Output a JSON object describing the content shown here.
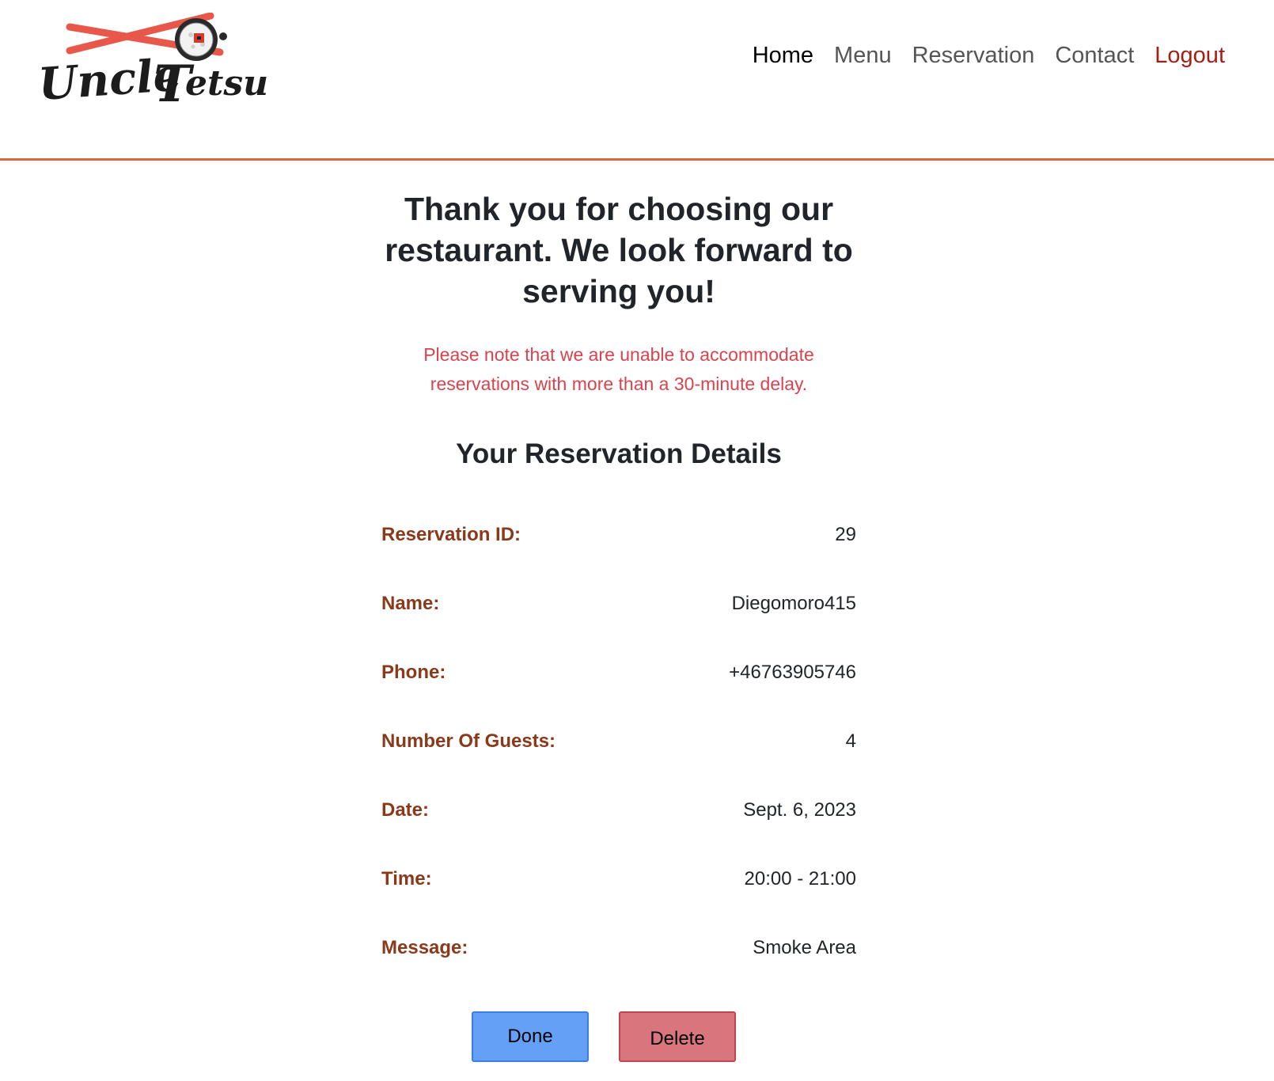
{
  "brand": {
    "logo_text": "Uncle Tetsu",
    "colors": {
      "chopsticks": "#e8584a",
      "text": "#1c1c1c"
    }
  },
  "nav": {
    "items": [
      {
        "label": "Home",
        "active": true
      },
      {
        "label": "Menu"
      },
      {
        "label": "Reservation"
      },
      {
        "label": "Contact"
      },
      {
        "label": "Logout"
      }
    ]
  },
  "main": {
    "thanks": "Thank you for choosing our restaurant. We look forward to serving you!",
    "note": "Please note that we are unable to accommodate reservations with more than a 30-minute delay.",
    "details_title": "Your Reservation Details",
    "details": [
      {
        "label": "Reservation ID:",
        "value": "29"
      },
      {
        "label": "Name:",
        "value": "Diegomoro415"
      },
      {
        "label": "Phone:",
        "value": "+46763905746"
      },
      {
        "label": "Number Of Guests:",
        "value": "4"
      },
      {
        "label": "Date:",
        "value": "Sept. 6, 2023"
      },
      {
        "label": "Time:",
        "value": "20:00 - 21:00"
      },
      {
        "label": "Message:",
        "value": "Smoke Area"
      }
    ],
    "buttons": {
      "done": "Done",
      "delete": "Delete"
    }
  },
  "colors": {
    "header_border": "#d9693c",
    "label": "#8a3a1b",
    "note": "#d9434e",
    "logout": "#a31f16",
    "done_button": "#64a0f5",
    "delete_button": "#d9767d"
  }
}
